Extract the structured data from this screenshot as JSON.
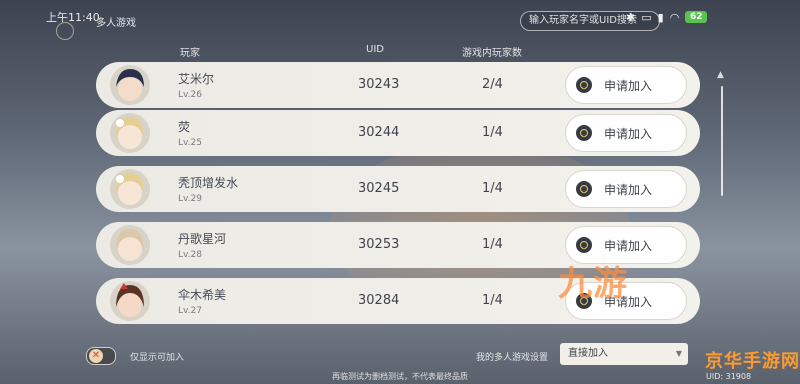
{
  "status_bar": {
    "time": "上午11:40",
    "battery": "62"
  },
  "header": {
    "title": "多人游戏",
    "search_placeholder": "输入玩家名字或UID搜索"
  },
  "columns": {
    "player": "玩家",
    "uid": "UID",
    "count": "游戏内玩家数"
  },
  "players": [
    {
      "name": "艾米尔",
      "level": "Lv.26",
      "uid": "30243",
      "count": "2/4",
      "action": "申请加入",
      "hair": "#2b2f4a",
      "skin": "#f3dcc9"
    },
    {
      "name": "荧",
      "level": "Lv.25",
      "uid": "30244",
      "count": "1/4",
      "action": "申请加入",
      "hair": "#e6cf93",
      "skin": "#f7e6d6"
    },
    {
      "name": "秃顶增发水",
      "level": "Lv.29",
      "uid": "30245",
      "count": "1/4",
      "action": "申请加入",
      "hair": "#e6cf93",
      "skin": "#f7e6d6"
    },
    {
      "name": "丹歌星河",
      "level": "Lv.28",
      "uid": "30253",
      "count": "1/4",
      "action": "申请加入",
      "hair": "#dcc7a8",
      "skin": "#f6e3d3"
    },
    {
      "name": "伞木希美",
      "level": "Lv.27",
      "uid": "30284",
      "count": "1/4",
      "action": "申请加入",
      "hair": "#5b3326",
      "skin": "#f3d9c6"
    }
  ],
  "bottom": {
    "toggle_label": "仅显示可加入",
    "settings_label": "我的多人游戏设置",
    "settings_value": "直接加入",
    "footer_text": "再临测试为删档测试，不代表最终品质",
    "uid_text": "UID: 31908"
  },
  "overlay": {
    "watermark_text": "九游",
    "brand_text": "京华手游网"
  },
  "colors": {
    "row_bg": "#eceae4",
    "accent_gold": "#e9c46a",
    "icon_dark": "#363a43"
  }
}
